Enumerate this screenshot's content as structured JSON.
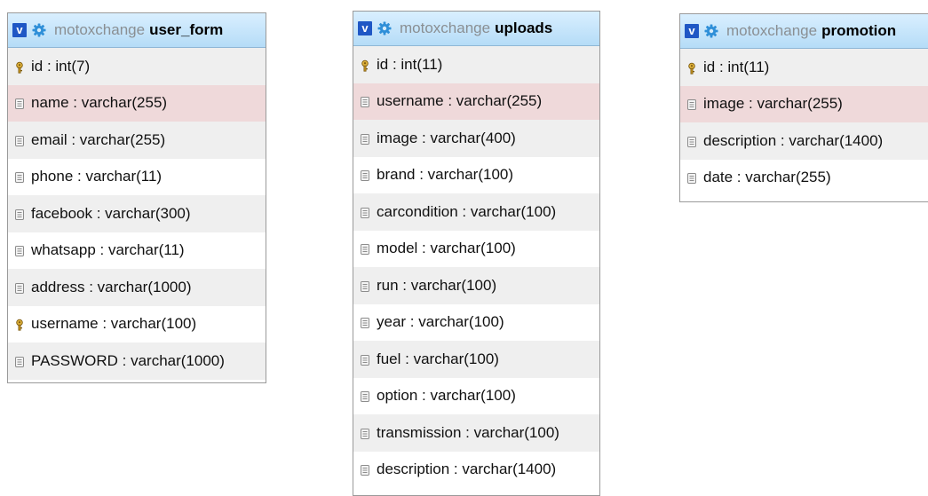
{
  "tables": [
    {
      "db": "motoxchange",
      "name": "user_form",
      "columns": [
        {
          "label": "id : int(7)",
          "icon": "key-icon",
          "highlight": false
        },
        {
          "label": "name : varchar(255)",
          "icon": "column-icon",
          "highlight": true
        },
        {
          "label": "email : varchar(255)",
          "icon": "column-icon",
          "highlight": false
        },
        {
          "label": "phone : varchar(11)",
          "icon": "column-icon",
          "highlight": false
        },
        {
          "label": "facebook : varchar(300)",
          "icon": "column-icon",
          "highlight": false
        },
        {
          "label": "whatsapp : varchar(11)",
          "icon": "column-icon",
          "highlight": false
        },
        {
          "label": "address : varchar(1000)",
          "icon": "column-icon",
          "highlight": false
        },
        {
          "label": "username : varchar(100)",
          "icon": "key-icon",
          "highlight": false
        },
        {
          "label": "PASSWORD : varchar(1000)",
          "icon": "column-icon",
          "highlight": false
        }
      ]
    },
    {
      "db": "motoxchange",
      "name": "uploads",
      "columns": [
        {
          "label": "id : int(11)",
          "icon": "key-icon",
          "highlight": false
        },
        {
          "label": "username : varchar(255)",
          "icon": "column-icon",
          "highlight": true
        },
        {
          "label": "image : varchar(400)",
          "icon": "column-icon",
          "highlight": false
        },
        {
          "label": "brand : varchar(100)",
          "icon": "column-icon",
          "highlight": false
        },
        {
          "label": "carcondition : varchar(100)",
          "icon": "column-icon",
          "highlight": false
        },
        {
          "label": "model : varchar(100)",
          "icon": "column-icon",
          "highlight": false
        },
        {
          "label": "run : varchar(100)",
          "icon": "column-icon",
          "highlight": false
        },
        {
          "label": "year : varchar(100)",
          "icon": "column-icon",
          "highlight": false
        },
        {
          "label": "fuel : varchar(100)",
          "icon": "column-icon",
          "highlight": false
        },
        {
          "label": "option : varchar(100)",
          "icon": "column-icon",
          "highlight": false
        },
        {
          "label": "transmission : varchar(100)",
          "icon": "column-icon",
          "highlight": false
        },
        {
          "label": "description : varchar(1400)",
          "icon": "column-icon",
          "highlight": false
        }
      ]
    },
    {
      "db": "motoxchange",
      "name": "promotion",
      "columns": [
        {
          "label": "id : int(11)",
          "icon": "key-icon",
          "highlight": false
        },
        {
          "label": "image : varchar(255)",
          "icon": "column-icon",
          "highlight": true
        },
        {
          "label": "description : varchar(1400)",
          "icon": "column-icon",
          "highlight": false
        },
        {
          "label": "date : varchar(255)",
          "icon": "column-icon",
          "highlight": false
        }
      ]
    }
  ],
  "ui": {
    "collapse_label": "v"
  },
  "colors": {
    "header": "#b5dcf7",
    "highlight_row": "#efd9da",
    "alt_row": "#efefef",
    "v_button": "#1f57c5"
  }
}
